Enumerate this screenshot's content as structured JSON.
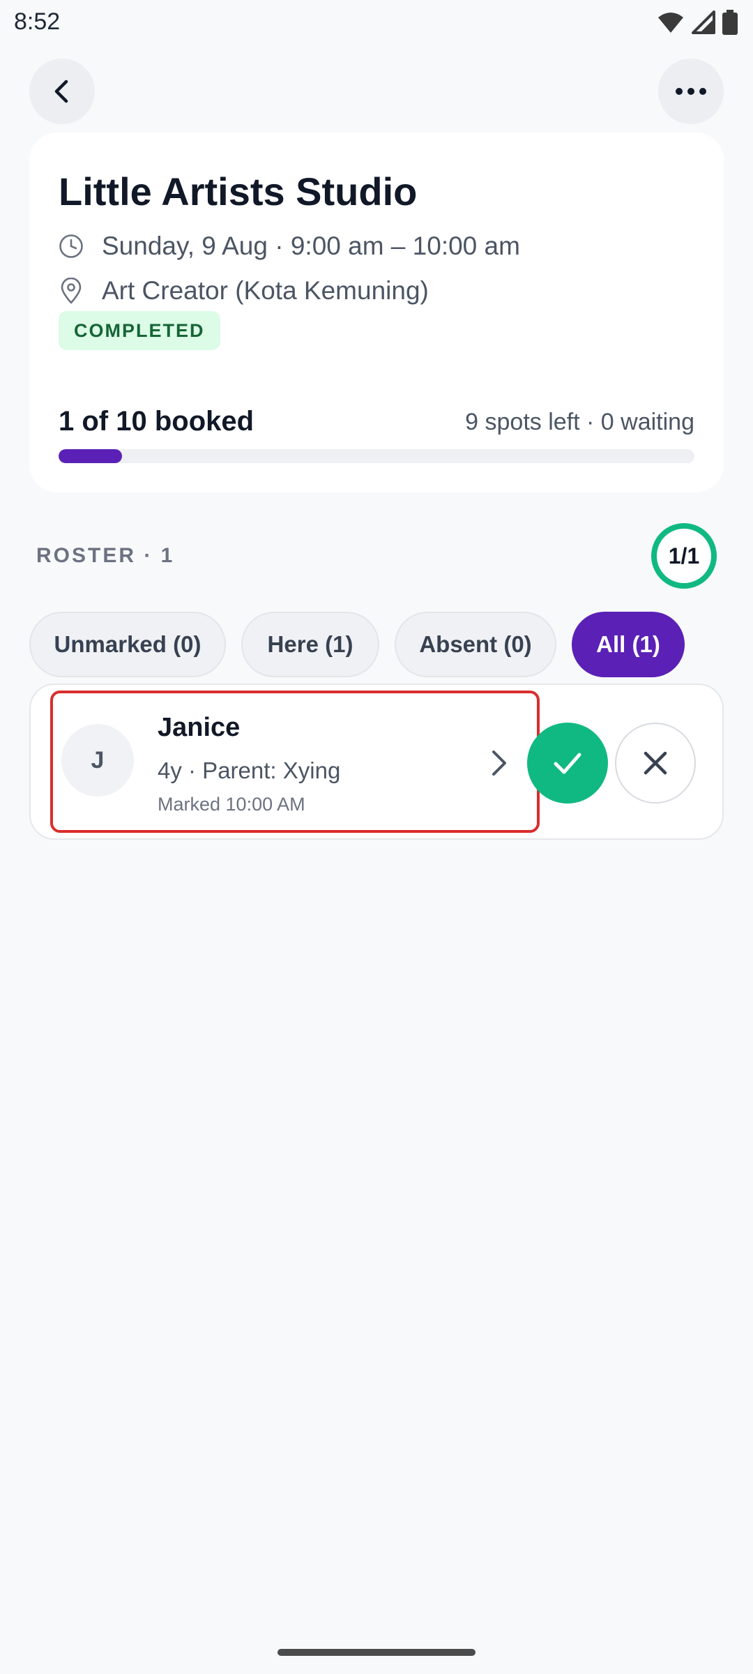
{
  "status_bar": {
    "time": "8:52",
    "icons": [
      "wifi-icon",
      "signal-icon",
      "battery-icon"
    ]
  },
  "header": {
    "back_icon": "chevron-left-icon",
    "more_icon": "more-horizontal-icon"
  },
  "session": {
    "title": "Little Artists Studio",
    "datetime": "Sunday, 9 Aug · 9:00 am – 10:00 am",
    "location": "Art Creator (Kota Kemuning)",
    "status": "COMPLETED",
    "booked": "1 of 10 booked",
    "availability": "9 spots left · 0 waiting",
    "booked_fraction": 0.1
  },
  "roster": {
    "label": "ROSTER · 1",
    "count": "1/1",
    "filters": [
      {
        "label": "Unmarked (0)",
        "active": false
      },
      {
        "label": "Here (1)",
        "active": false
      },
      {
        "label": "Absent (0)",
        "active": false
      },
      {
        "label": "All (1)",
        "active": true
      }
    ],
    "items": [
      {
        "initial": "J",
        "name": "Janice",
        "meta": "4y · Parent: Xying",
        "marked": "Marked 10:00 AM",
        "status": "here"
      }
    ]
  },
  "colors": {
    "accent": "#5b21b6",
    "success": "#10b981",
    "badge_bg": "#dcfce7",
    "badge_text": "#166534",
    "highlight": "#d92d2d"
  }
}
